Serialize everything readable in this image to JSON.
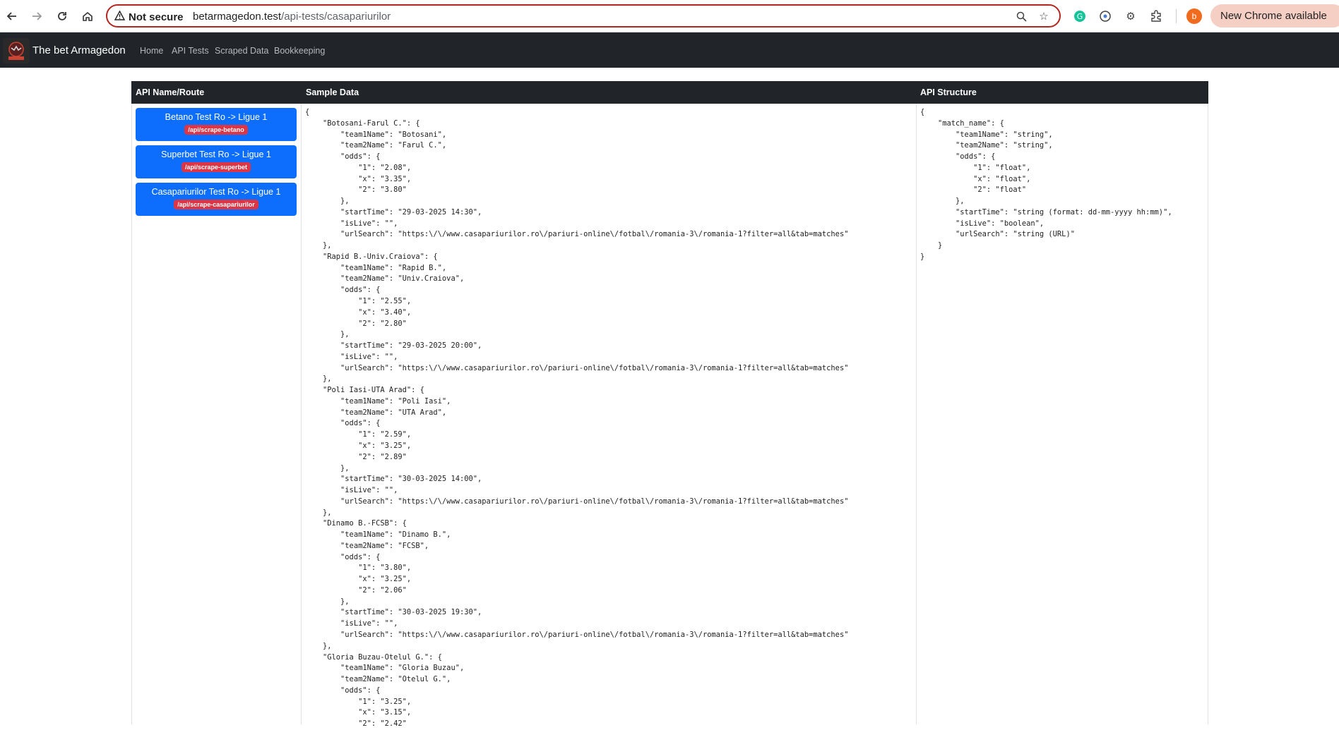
{
  "browser": {
    "security_label": "Not secure",
    "url_host": "betarmagedon.test",
    "url_path": "/api-tests/casapariurilor",
    "update_label": "New Chrome available",
    "profile_initial": "b"
  },
  "navbar": {
    "brand": "The bet Armagedon",
    "links": [
      "Home",
      "API Tests",
      "Scraped Data",
      "Bookkeeping"
    ]
  },
  "table": {
    "headers": [
      "API Name/Route",
      "Sample Data",
      "API Structure"
    ],
    "apis": [
      {
        "label": "Betano Test Ro -> Ligue 1",
        "route": "/api/scrape-betano"
      },
      {
        "label": "Superbet Test Ro -> Ligue 1",
        "route": "/api/scrape-superbet"
      },
      {
        "label": "Casapariurilor Test Ro -> Ligue 1",
        "route": "/api/scrape-casapariurilor"
      }
    ],
    "sample_data": "{\n    \"Botosani-Farul C.\": {\n        \"team1Name\": \"Botosani\",\n        \"team2Name\": \"Farul C.\",\n        \"odds\": {\n            \"1\": \"2.08\",\n            \"x\": \"3.35\",\n            \"2\": \"3.80\"\n        },\n        \"startTime\": \"29-03-2025 14:30\",\n        \"isLive\": \"\",\n        \"urlSearch\": \"https:\\/\\/www.casapariurilor.ro\\/pariuri-online\\/fotbal\\/romania-3\\/romania-1?filter=all&tab=matches\"\n    },\n    \"Rapid B.-Univ.Craiova\": {\n        \"team1Name\": \"Rapid B.\",\n        \"team2Name\": \"Univ.Craiova\",\n        \"odds\": {\n            \"1\": \"2.55\",\n            \"x\": \"3.40\",\n            \"2\": \"2.80\"\n        },\n        \"startTime\": \"29-03-2025 20:00\",\n        \"isLive\": \"\",\n        \"urlSearch\": \"https:\\/\\/www.casapariurilor.ro\\/pariuri-online\\/fotbal\\/romania-3\\/romania-1?filter=all&tab=matches\"\n    },\n    \"Poli Iasi-UTA Arad\": {\n        \"team1Name\": \"Poli Iasi\",\n        \"team2Name\": \"UTA Arad\",\n        \"odds\": {\n            \"1\": \"2.59\",\n            \"x\": \"3.25\",\n            \"2\": \"2.89\"\n        },\n        \"startTime\": \"30-03-2025 14:00\",\n        \"isLive\": \"\",\n        \"urlSearch\": \"https:\\/\\/www.casapariurilor.ro\\/pariuri-online\\/fotbal\\/romania-3\\/romania-1?filter=all&tab=matches\"\n    },\n    \"Dinamo B.-FCSB\": {\n        \"team1Name\": \"Dinamo B.\",\n        \"team2Name\": \"FCSB\",\n        \"odds\": {\n            \"1\": \"3.80\",\n            \"x\": \"3.25\",\n            \"2\": \"2.06\"\n        },\n        \"startTime\": \"30-03-2025 19:30\",\n        \"isLive\": \"\",\n        \"urlSearch\": \"https:\\/\\/www.casapariurilor.ro\\/pariuri-online\\/fotbal\\/romania-3\\/romania-1?filter=all&tab=matches\"\n    },\n    \"Gloria Buzau-Otelul G.\": {\n        \"team1Name\": \"Gloria Buzau\",\n        \"team2Name\": \"Otelul G.\",\n        \"odds\": {\n            \"1\": \"3.25\",\n            \"x\": \"3.15\",\n            \"2\": \"2.42\"",
    "structure": "{\n    \"match_name\": {\n        \"team1Name\": \"string\",\n        \"team2Name\": \"string\",\n        \"odds\": {\n            \"1\": \"float\",\n            \"x\": \"float\",\n            \"2\": \"float\"\n        },\n        \"startTime\": \"string (format: dd-mm-yyyy hh:mm)\",\n        \"isLive\": \"boolean\",\n        \"urlSearch\": \"string (URL)\"\n    }\n}"
  }
}
